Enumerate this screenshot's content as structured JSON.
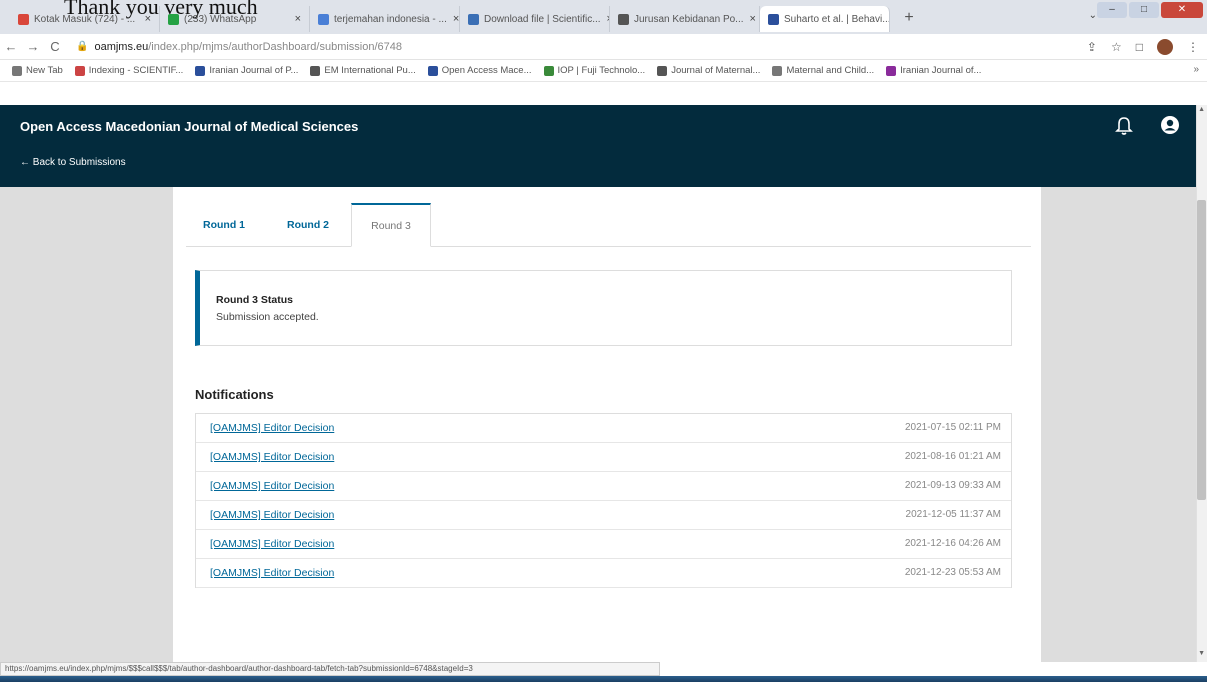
{
  "overlay_text": "Thank you very much",
  "browser": {
    "tabs": [
      {
        "label": "Kotak Masuk (724) - ...",
        "color": "#d9463a"
      },
      {
        "label": "(233) WhatsApp",
        "color": "#25a244"
      },
      {
        "label": "terjemahan indonesia - ...",
        "color": "#4a7fd6"
      },
      {
        "label": "Download file | Scientific...",
        "color": "#3b6fb5"
      },
      {
        "label": "Jurusan Kebidanan Po...",
        "color": "#555555"
      },
      {
        "label": "Suharto et al. | Behavi...",
        "color": "#2b4f9b"
      }
    ],
    "new_tab": "+",
    "url_host": "oamjms.eu",
    "url_path": "/index.php/mjms/authorDashboard/submission/6748",
    "bookmarks": [
      {
        "label": "New Tab",
        "color": "#777777"
      },
      {
        "label": "Indexing - SCIENTIF...",
        "color": "#c44"
      },
      {
        "label": "Iranian Journal of P...",
        "color": "#2b4f9b"
      },
      {
        "label": "EM International Pu...",
        "color": "#555555"
      },
      {
        "label": "Open Access Mace...",
        "color": "#2b4f9b"
      },
      {
        "label": "IOP | Fuji Technolo...",
        "color": "#3a8a3a"
      },
      {
        "label": "Journal of Maternal...",
        "color": "#555555"
      },
      {
        "label": "Maternal and Child...",
        "color": "#777777"
      },
      {
        "label": "Iranian Journal of...",
        "color": "#8a2b9b"
      }
    ]
  },
  "app": {
    "title": "Open Access Macedonian Journal of Medical Sciences",
    "back_label": "← Back to Submissions"
  },
  "rounds": {
    "tabs": [
      "Round 1",
      "Round 2",
      "Round 3"
    ],
    "active": "Round 3"
  },
  "status": {
    "title": "Round 3 Status",
    "text": "Submission accepted."
  },
  "notifications": {
    "heading": "Notifications",
    "items": [
      {
        "label": "[OAMJMS] Editor Decision",
        "date": "2021-07-15 02:11 PM"
      },
      {
        "label": "[OAMJMS] Editor Decision",
        "date": "2021-08-16 01:21 AM"
      },
      {
        "label": "[OAMJMS] Editor Decision",
        "date": "2021-09-13 09:33 AM"
      },
      {
        "label": "[OAMJMS] Editor Decision",
        "date": "2021-12-05 11:37 AM"
      },
      {
        "label": "[OAMJMS] Editor Decision",
        "date": "2021-12-16 04:26 AM"
      },
      {
        "label": "[OAMJMS] Editor Decision",
        "date": "2021-12-23 05:53 AM"
      }
    ]
  },
  "status_url": "https://oamjms.eu/index.php/mjms/$$$call$$$/tab/author-dashboard/author-dashboard-tab/fetch-tab?submissionId=6748&stageId=3"
}
